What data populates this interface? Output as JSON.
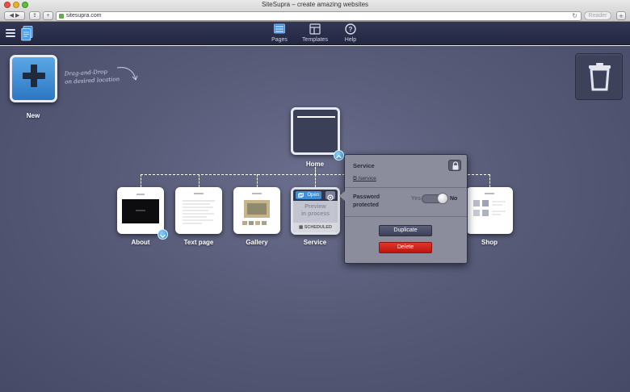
{
  "browser": {
    "window_title": "SiteSupra – create amazing websites",
    "url": "sitesupra.com",
    "reader_label": "Reader"
  },
  "appbar": {
    "nav": [
      {
        "label": "Pages",
        "icon": "pages-icon"
      },
      {
        "label": "Templates",
        "icon": "templates-icon"
      },
      {
        "label": "Help",
        "icon": "help-icon"
      }
    ]
  },
  "canvas": {
    "new_label": "New",
    "hint_line1": "Drag-and-Drop",
    "hint_line2": "on desired location",
    "home_label": "Home",
    "children": [
      {
        "label": "About"
      },
      {
        "label": "Text page"
      },
      {
        "label": "Gallery"
      },
      {
        "label": "Service"
      },
      {
        "label": "Shop"
      }
    ],
    "service_tile": {
      "open_label": "Open",
      "preview_line1": "Preview",
      "preview_line2": "in process",
      "scheduled_label": "SCHEDULED"
    }
  },
  "popup": {
    "title": "Service",
    "path": "/service",
    "password_line1": "Password",
    "password_line2": "protected",
    "toggle_yes": "Yes",
    "toggle_no": "No",
    "toggle_value": "No",
    "duplicate_label": "Duplicate",
    "delete_label": "Delete"
  },
  "colors": {
    "accent": "#3e8fd8",
    "delete": "#d1241c",
    "header": "#2a2e4a"
  }
}
